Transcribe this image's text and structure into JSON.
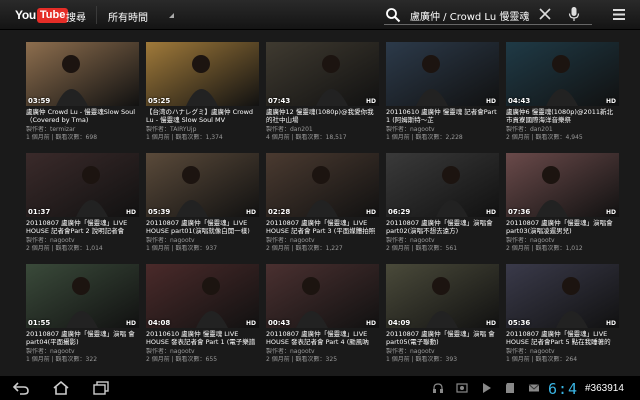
{
  "app": {
    "logo_you": "You",
    "logo_tube": "Tube"
  },
  "header": {
    "search_tab": "搜尋",
    "time_filter": "所有時間",
    "search_query": "盧廣仲 / Crowd Lu 慢靈魂"
  },
  "videos": [
    {
      "duration": "03:59",
      "hd": "",
      "title": "盧廣仲 Crowd Lu - 慢靈魂Slow Soul（Covered by Tma)",
      "uploader": "製作者：termizar",
      "stats": "1 個月前 | 觀看次數：698",
      "thumb_color": "#8d6e4e"
    },
    {
      "duration": "05:25",
      "hd": "",
      "title": "【台湾のハナレグミ】盧廣仲 Crowd Lu - 慢靈魂 Slow Soul MV",
      "uploader": "製作者：TAIRYUjp",
      "stats": "1 個月前 | 觀看次數：1,374",
      "thumb_color": "#a07a3a"
    },
    {
      "duration": "07:43",
      "hd": "HD",
      "title": "盧廣仲12 慢靈魂(1080p)@我愛你我的社中山場",
      "uploader": "製作者：dan201",
      "stats": "4 個月前 | 觀看次數：18,517",
      "thumb_color": "#3f3a30"
    },
    {
      "duration": "",
      "hd": "HD",
      "title": "20110610 盧廣仲 慢靈魂 記者會Part 1 (阿姆斯特～芷",
      "uploader": "製作者：nagootv",
      "stats": "1 個月前 | 觀看次數：2,228",
      "thumb_color": "#2c3a4a"
    },
    {
      "duration": "04:43",
      "hd": "HD",
      "title": "盧廣仲6 慢靈魂(1080p)@2011新北市貢寮國際海洋音樂祭",
      "uploader": "製作者：dan201",
      "stats": "2 個月前 | 觀看次數：4,945",
      "thumb_color": "#1f3a46"
    },
    {
      "duration": "01:37",
      "hd": "HD",
      "title": "20110807 盧廣仲「慢靈魂」LIVE HOUSE 記者會Part 2 說明記者會",
      "uploader": "製作者：nagootv",
      "stats": "2 個月前 | 觀看次數：1,014",
      "thumb_color": "#3a2a2a"
    },
    {
      "duration": "05:39",
      "hd": "HD",
      "title": "20110807 盧廣仲「慢靈魂」LIVE HOUSE part01(演唱就像白開一樣)",
      "uploader": "製作者：nagootv",
      "stats": "1 個月前 | 觀看次數：937",
      "thumb_color": "#5a4a3a"
    },
    {
      "duration": "02:28",
      "hd": "HD",
      "title": "20110807 盧廣仲「慢靈魂」LIVE HOUSE 記者會 Part 3 (平面媒體拍照",
      "uploader": "製作者：nagootv",
      "stats": "2 個月前 | 觀看次數：1,227",
      "thumb_color": "#4a3a30"
    },
    {
      "duration": "06:29",
      "hd": "HD",
      "title": "20110807 盧廣仲「慢靈魂」演唱會 part02(演唱不想去遠方)",
      "uploader": "製作者：nagootv",
      "stats": "2 個月前 | 觀看次數：561",
      "thumb_color": "#3a3a3a"
    },
    {
      "duration": "07:36",
      "hd": "HD",
      "title": "20110807 盧廣仲「慢靈魂」演唱會 part03(演唱凌遲男兒)",
      "uploader": "製作者：nagootv",
      "stats": "2 個月前 | 觀看次數：1,012",
      "thumb_color": "#6a4a4a"
    },
    {
      "duration": "01:55",
      "hd": "HD",
      "title": "20110807 盧廣仲「慢靈魂」演唱 會part04(平面攝影)",
      "uploader": "製作者：nagootv",
      "stats": "1 個月前 | 觀看次數：322",
      "thumb_color": "#3a4a3a"
    },
    {
      "duration": "04:08",
      "hd": "HD",
      "title": "20110610 盧廣仲 慢靈魂 LIVE HOUSE 發表記者會 Part 1 (電子樂譜",
      "uploader": "製作者：nagootv",
      "stats": "2 個月前 | 觀看次數：655",
      "thumb_color": "#4a2a2a"
    },
    {
      "duration": "00:43",
      "hd": "HD",
      "title": "20110807 盧廣仲「慢靈魂」LIVE HOUSE 發表記者會 Part 4 (颱風吶",
      "uploader": "製作者：nagootv",
      "stats": "2 個月前 | 觀看次數：325",
      "thumb_color": "#4a3030"
    },
    {
      "duration": "04:09",
      "hd": "HD",
      "title": "20110807 盧廣仲「慢靈魂」演唱 會part05(電子聯動)",
      "uploader": "製作者：nagootv",
      "stats": "1 個月前 | 觀看次數：393",
      "thumb_color": "#4a4a3a"
    },
    {
      "duration": "05:36",
      "hd": "HD",
      "title": "20110807 盧廣仲「慢靈魂」LIVE HOUSE 記者會Part 5 點在我睡著的",
      "uploader": "製作者：nagootv",
      "stats": "1 個月前 | 觀看次數：264",
      "thumb_color": "#3a3a4a"
    }
  ],
  "status": {
    "clock": "6:4",
    "watermark": "#363914"
  },
  "colors": {
    "accent": "#3ab5e4",
    "brand_red": "#e52d27",
    "background": "#1a1a1a"
  },
  "icons": [
    "back-icon",
    "home-icon",
    "recent-apps-icon",
    "headphones-icon",
    "media-icon",
    "play-icon",
    "sd-card-icon",
    "mail-icon"
  ]
}
